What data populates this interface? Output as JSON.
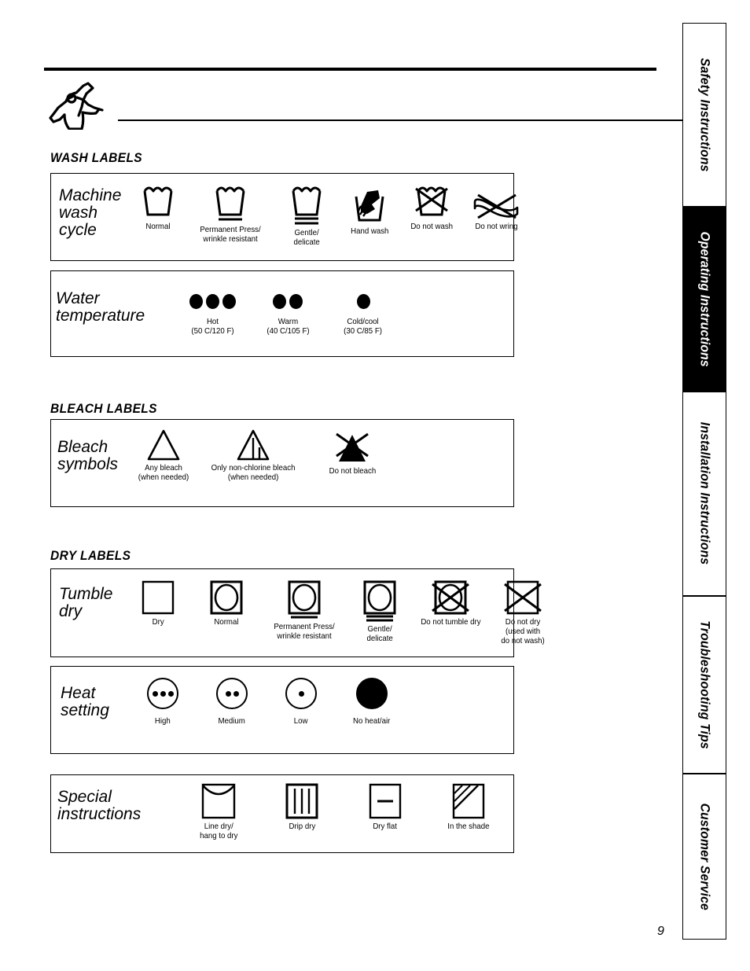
{
  "page": {
    "number": "9",
    "garment_icon": "garment-hanging-icon"
  },
  "sections": [
    {
      "id": "wash",
      "title": "WASH LABELS"
    },
    {
      "id": "bleach",
      "title": "BLEACH LABELS"
    },
    {
      "id": "dry",
      "title": "DRY LABELS"
    }
  ],
  "panels": {
    "machine_wash": {
      "label": "Machine\nwash\ncycle",
      "symbols": [
        {
          "icon": "wash-tub-icon",
          "caption": "Normal"
        },
        {
          "icon": "wash-tub-one-bar-icon",
          "caption": "Permanent Press/\nwrinkle resistant"
        },
        {
          "icon": "wash-tub-two-bar-icon",
          "caption": "Gentle/\ndelicate"
        },
        {
          "icon": "hand-wash-icon",
          "caption": "Hand wash"
        },
        {
          "icon": "do-not-wash-icon",
          "caption": "Do not wash"
        },
        {
          "icon": "do-not-wring-icon",
          "caption": "Do not wring"
        }
      ]
    },
    "water_temperature": {
      "label": "Water\ntemperature",
      "symbols": [
        {
          "icon": "three-dots-icon",
          "dots": 3,
          "caption": "Hot\n(50 C/120 F)"
        },
        {
          "icon": "two-dots-icon",
          "dots": 2,
          "caption": "Warm\n(40 C/105 F)"
        },
        {
          "icon": "one-dot-icon",
          "dots": 1,
          "caption": "Cold/cool\n(30 C/85 F)"
        }
      ]
    },
    "bleach": {
      "label": "Bleach\nsymbols",
      "symbols": [
        {
          "icon": "triangle-outline-icon",
          "caption": "Any bleach\n(when needed)"
        },
        {
          "icon": "triangle-striped-icon",
          "caption": "Only non-chlorine bleach\n(when needed)"
        },
        {
          "icon": "do-not-bleach-icon",
          "caption": "Do not bleach"
        }
      ]
    },
    "tumble_dry": {
      "label": "Tumble\ndry",
      "symbols": [
        {
          "icon": "square-icon",
          "caption": "Dry"
        },
        {
          "icon": "tumble-dry-icon",
          "caption": "Normal"
        },
        {
          "icon": "tumble-dry-one-bar-icon",
          "caption": "Permanent Press/\nwrinkle resistant"
        },
        {
          "icon": "tumble-dry-two-bar-icon",
          "caption": "Gentle/\ndelicate"
        },
        {
          "icon": "do-not-tumble-dry-icon",
          "caption": "Do not tumble dry"
        },
        {
          "icon": "do-not-dry-icon",
          "caption": "Do not dry\n(used with\ndo not wash)"
        }
      ]
    },
    "heat_setting": {
      "label": "Heat\nsetting",
      "symbols": [
        {
          "icon": "circle-three-dots-icon",
          "dots": 3,
          "filled": false,
          "caption": "High"
        },
        {
          "icon": "circle-two-dots-icon",
          "dots": 2,
          "filled": false,
          "caption": "Medium"
        },
        {
          "icon": "circle-one-dot-icon",
          "dots": 1,
          "filled": false,
          "caption": "Low"
        },
        {
          "icon": "circle-filled-icon",
          "dots": 0,
          "filled": true,
          "caption": "No heat/air"
        }
      ]
    },
    "special_instructions": {
      "label": "Special\ninstructions",
      "symbols": [
        {
          "icon": "line-dry-icon",
          "caption": "Line dry/\nhang to dry"
        },
        {
          "icon": "drip-dry-icon",
          "caption": "Drip dry"
        },
        {
          "icon": "dry-flat-icon",
          "caption": "Dry flat"
        },
        {
          "icon": "in-the-shade-icon",
          "caption": "In the shade"
        }
      ]
    }
  },
  "sidebar_tabs": [
    {
      "label": "Safety Instructions",
      "active": false
    },
    {
      "label": "Operating Instructions",
      "active": true
    },
    {
      "label": "Installation Instructions",
      "active": false
    },
    {
      "label": "Troubleshooting Tips",
      "active": false
    },
    {
      "label": "Customer Service",
      "active": false
    }
  ],
  "colors": {
    "ink": "#000000",
    "paper": "#ffffff",
    "active_tab_bg": "#000000",
    "active_tab_text": "#ffffff"
  }
}
